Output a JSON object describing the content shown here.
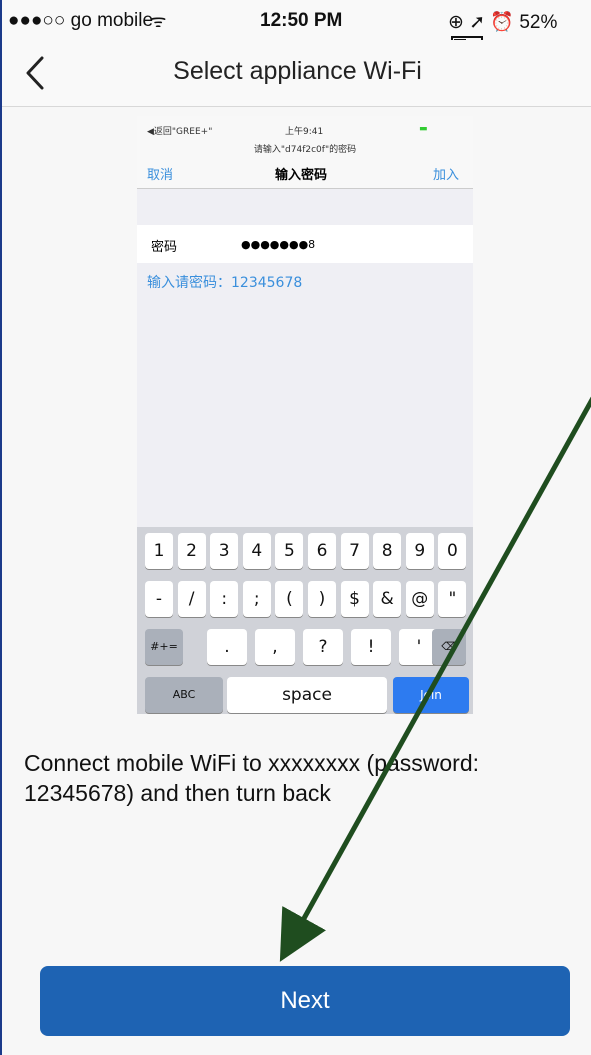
{
  "status_bar": {
    "carrier": "●●●○○ go mobile",
    "time": "12:50 PM",
    "battery": "52%",
    "battery_level": 0.52
  },
  "nav": {
    "title": "Select appliance Wi-Fi"
  },
  "guide_image": {
    "status_left": "◀返回\"GREE+\"",
    "status_time": "上午9:41",
    "prompt": "请输入\"d74f2c0f\"的密码",
    "cancel": "取消",
    "title": "输入密码",
    "join": "加入",
    "password_label": "密码",
    "password_value": "●●●●●●●8",
    "hint": "输入请密码：12345678",
    "keyboard": {
      "row1": [
        "1",
        "2",
        "3",
        "4",
        "5",
        "6",
        "7",
        "8",
        "9",
        "0"
      ],
      "row2": [
        "-",
        "/",
        ":",
        ";",
        "(",
        ")",
        "$",
        "&",
        "@",
        "\""
      ],
      "row3": [
        "#+=",
        ".",
        ",",
        "?",
        "!",
        "'",
        "⌫"
      ],
      "row4": [
        "ABC",
        "space",
        "Join"
      ]
    }
  },
  "caption": "Connect mobile WiFi to xxxxxxxx (password: 12345678) and then turn back",
  "next_button": "Next",
  "colors": {
    "primary": "#1e63b3",
    "arrow": "#1f4d1f",
    "hint": "#3a8fdc"
  }
}
